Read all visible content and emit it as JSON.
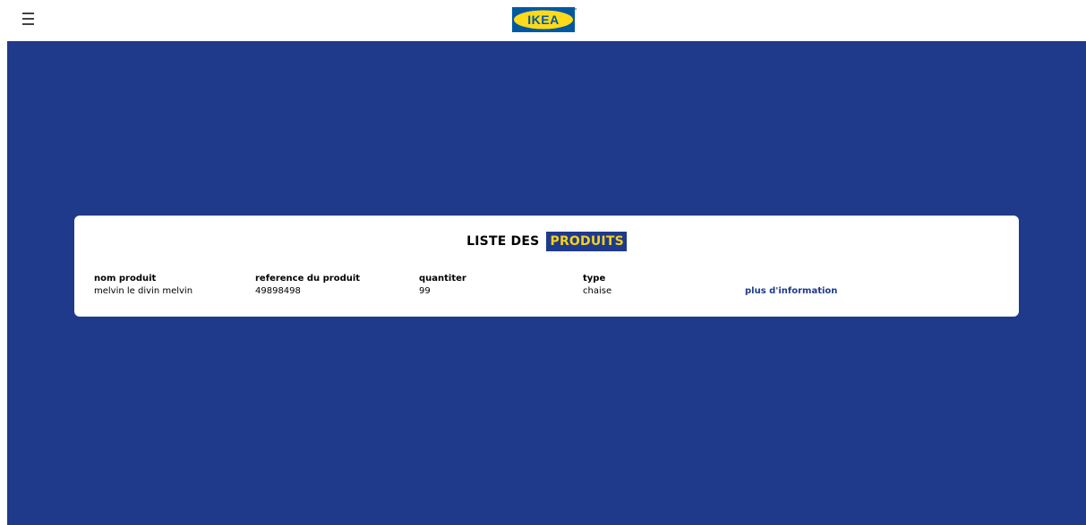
{
  "header": {
    "logo_text": "IKEA",
    "menu_icon": "hamburger-menu-icon"
  },
  "colors": {
    "brand_blue": "#1f3a8b",
    "brand_yellow": "#f5d11b"
  },
  "card": {
    "title_plain": "LISTE DES",
    "title_highlight": "PRODUITS",
    "columns": [
      {
        "header": "nom produit",
        "value": "melvin le divin melvin"
      },
      {
        "header": "reference du produit",
        "value": "49898498"
      },
      {
        "header": "quantiter",
        "value": "99"
      },
      {
        "header": "type",
        "value": "chaise"
      }
    ],
    "link_label": "plus d'information"
  }
}
